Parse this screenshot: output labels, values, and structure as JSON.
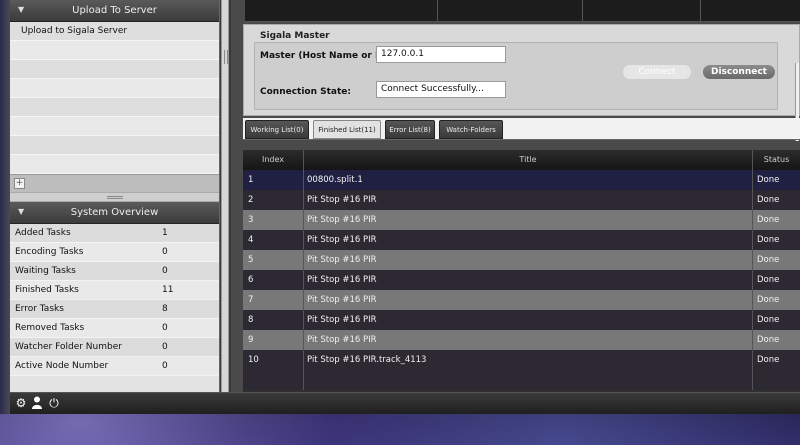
{
  "upload_section": {
    "header": "Upload To Server",
    "items": [
      "Upload to Sigala Server"
    ],
    "add_label": "+"
  },
  "overview": {
    "header": "System Overview",
    "rows": [
      {
        "label": "Added Tasks",
        "value": "1"
      },
      {
        "label": "Encoding Tasks",
        "value": "0"
      },
      {
        "label": "Waiting Tasks",
        "value": "0"
      },
      {
        "label": "Finished Tasks",
        "value": "11"
      },
      {
        "label": "Error Tasks",
        "value": "8"
      },
      {
        "label": "Removed Tasks",
        "value": "0"
      },
      {
        "label": "Watcher Folder Number",
        "value": "0"
      },
      {
        "label": "Active Node Number",
        "value": "0"
      }
    ]
  },
  "master": {
    "title": "Sigala Master",
    "host_label": "Master (Host Name or IP):",
    "host_value": "127.0.0.1",
    "state_label": "Connection State:",
    "state_value": "Connect Successfully...",
    "connect_label": "Connect",
    "disconnect_label": "Disconnect"
  },
  "tabs": [
    {
      "label": "Working List(0)",
      "active": false
    },
    {
      "label": "Finished List(11)",
      "active": true
    },
    {
      "label": "Error List(8)",
      "active": false
    },
    {
      "label": "Watch-Folders",
      "active": false
    }
  ],
  "grid": {
    "headers": {
      "index": "Index",
      "title": "Title",
      "status": "Status"
    },
    "rows": [
      {
        "index": "1",
        "title": "00800.split.1",
        "status": "Done"
      },
      {
        "index": "2",
        "title": "Pit Stop #16 PIR",
        "status": "Done"
      },
      {
        "index": "3",
        "title": "Pit Stop #16 PIR",
        "status": "Done"
      },
      {
        "index": "4",
        "title": "Pit Stop #16 PIR",
        "status": "Done"
      },
      {
        "index": "5",
        "title": "Pit Stop #16 PIR",
        "status": "Done"
      },
      {
        "index": "6",
        "title": "Pit Stop #16 PIR",
        "status": "Done"
      },
      {
        "index": "7",
        "title": "Pit Stop #16 PIR",
        "status": "Done"
      },
      {
        "index": "8",
        "title": "Pit Stop #16 PIR",
        "status": "Done"
      },
      {
        "index": "9",
        "title": "Pit Stop #16 PIR",
        "status": "Done"
      },
      {
        "index": "10",
        "title": "Pit Stop #16 PIR.track_4113",
        "status": "Done"
      }
    ]
  },
  "bottom_icons": [
    "gear-icon",
    "user-icon",
    "power-icon"
  ]
}
